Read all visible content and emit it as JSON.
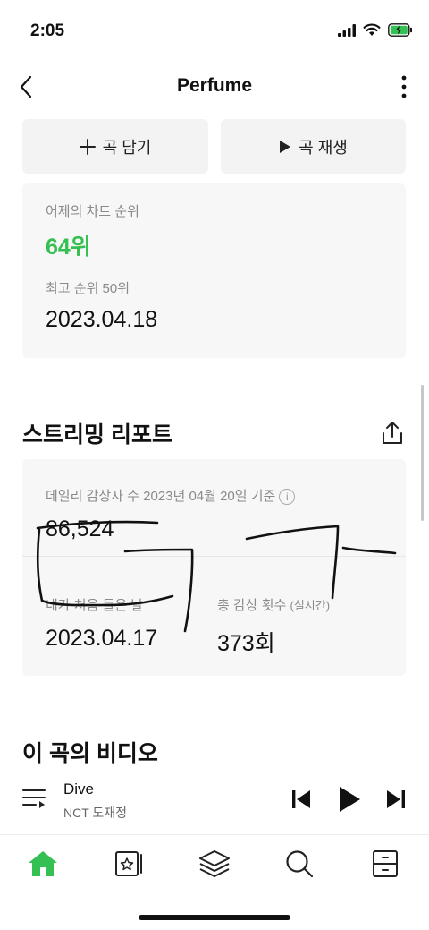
{
  "status_bar": {
    "time": "2:05"
  },
  "header": {
    "title": "Perfume"
  },
  "actions": {
    "add_label": "곡 담기",
    "play_label": "곡 재생"
  },
  "chart_rank": {
    "yesterday_label": "어제의 차트 순위",
    "yesterday_value": "64위",
    "best_label": "최고 순위 50위",
    "best_date": "2023.04.18"
  },
  "streaming_report": {
    "title": "스트리밍 리포트",
    "daily_listeners_label": "데일리 감상자 수 2023년 04월 20일 기준",
    "daily_listeners_value": "86,524",
    "first_listened_label": "내가 처음 들은 날",
    "first_listened_value": "2023.04.17",
    "total_plays_label": "총 감상 횟수",
    "total_plays_sub": "(실시간)",
    "total_plays_value": "373회"
  },
  "videos": {
    "title": "이 곡의 비디오"
  },
  "mini_player": {
    "title": "Dive",
    "artist": "NCT 도재정"
  },
  "colors": {
    "accent": "#34c052",
    "card_bg": "#f7f7f7",
    "button_bg": "#f3f3f3"
  }
}
